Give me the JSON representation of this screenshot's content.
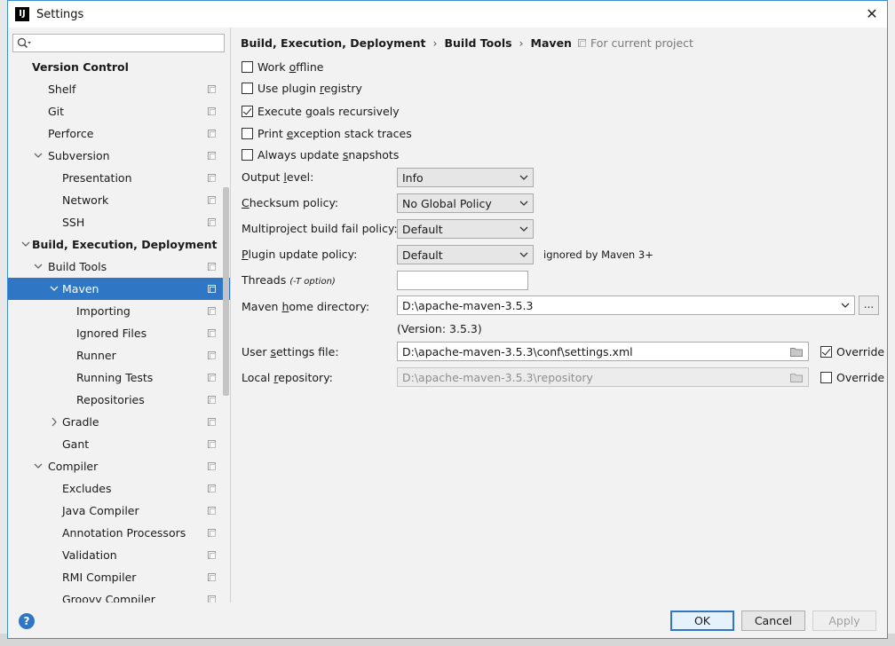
{
  "window": {
    "title": "Settings",
    "app_icon_text": "IJ",
    "close_glyph": "✕"
  },
  "sidebar": {
    "search": {
      "value": "",
      "placeholder": ""
    },
    "items": [
      {
        "label": "Version Control",
        "level": 0,
        "bold": true,
        "arrow": "",
        "project": false
      },
      {
        "label": "Shelf",
        "level": 1,
        "arrow": "",
        "project": true
      },
      {
        "label": "Git",
        "level": 1,
        "arrow": "",
        "project": true
      },
      {
        "label": "Perforce",
        "level": 1,
        "arrow": "",
        "project": true
      },
      {
        "label": "Subversion",
        "level": 1,
        "arrow": "expanded",
        "project": true
      },
      {
        "label": "Presentation",
        "level": 2,
        "arrow": "",
        "project": true
      },
      {
        "label": "Network",
        "level": 2,
        "arrow": "",
        "project": true
      },
      {
        "label": "SSH",
        "level": 2,
        "arrow": "",
        "project": true
      },
      {
        "label": "Build, Execution, Deployment",
        "level": 0,
        "bold": true,
        "arrow": "expanded",
        "project": false
      },
      {
        "label": "Build Tools",
        "level": 1,
        "arrow": "expanded",
        "project": true
      },
      {
        "label": "Maven",
        "level": 2,
        "arrow": "expanded",
        "project": true,
        "selected": true
      },
      {
        "label": "Importing",
        "level": 3,
        "arrow": "",
        "project": true
      },
      {
        "label": "Ignored Files",
        "level": 3,
        "arrow": "",
        "project": true
      },
      {
        "label": "Runner",
        "level": 3,
        "arrow": "",
        "project": true
      },
      {
        "label": "Running Tests",
        "level": 3,
        "arrow": "",
        "project": true
      },
      {
        "label": "Repositories",
        "level": 3,
        "arrow": "",
        "project": true
      },
      {
        "label": "Gradle",
        "level": 2,
        "arrow": "collapsed",
        "project": true
      },
      {
        "label": "Gant",
        "level": 2,
        "arrow": "",
        "project": true
      },
      {
        "label": "Compiler",
        "level": 1,
        "arrow": "expanded",
        "project": true
      },
      {
        "label": "Excludes",
        "level": 2,
        "arrow": "",
        "project": true
      },
      {
        "label": "Java Compiler",
        "level": 2,
        "arrow": "",
        "project": true
      },
      {
        "label": "Annotation Processors",
        "level": 2,
        "arrow": "",
        "project": true
      },
      {
        "label": "Validation",
        "level": 2,
        "arrow": "",
        "project": true
      },
      {
        "label": "RMI Compiler",
        "level": 2,
        "arrow": "",
        "project": true
      },
      {
        "label": "Groovy Compiler",
        "level": 2,
        "arrow": "",
        "project": true
      }
    ]
  },
  "content": {
    "breadcrumb": {
      "part1": "Build, Execution, Deployment",
      "part2": "Build Tools",
      "part3": "Maven",
      "separator": "›"
    },
    "for_project": "For current project",
    "checkboxes": {
      "work_offline": {
        "pre": "Work ",
        "mn": "o",
        "post": "ffline",
        "checked": false
      },
      "plugin_registry": {
        "pre": "Use plugin ",
        "mn": "r",
        "post": "egistry",
        "checked": false
      },
      "execute_goals": {
        "pre": "Execute ",
        "mn": "g",
        "post": "oals recursively",
        "checked": true
      },
      "print_exception": {
        "pre": "Print ",
        "mn": "e",
        "post": "xception stack traces",
        "checked": false
      },
      "update_snapshots": {
        "pre": "Always update ",
        "mn": "s",
        "post": "napshots",
        "checked": false
      }
    },
    "output_level": {
      "pre": "Output ",
      "mn": "l",
      "post": "evel:",
      "value": "Info"
    },
    "checksum_policy": {
      "pre": "",
      "mn": "C",
      "post": "hecksum policy:",
      "value": "No Global Policy"
    },
    "multiproject": {
      "pre": "Multiproject build fail policy:",
      "value": "Default"
    },
    "plugin_update": {
      "pre": "",
      "mn": "P",
      "post": "lugin update policy:",
      "value": "Default",
      "note": "ignored by Maven 3+"
    },
    "threads": {
      "label": "Threads",
      "note": "(-T option)",
      "value": ""
    },
    "maven_home": {
      "pre": "Maven ",
      "mn": "h",
      "post": "ome directory:",
      "value": "D:\\apache-maven-3.5.3",
      "browse": "...",
      "version": "(Version: 3.5.3)"
    },
    "user_settings": {
      "pre": "User ",
      "mn": "s",
      "post": "ettings file:",
      "value": "D:\\apache-maven-3.5.3\\conf\\settings.xml",
      "override_label": "Override",
      "override_checked": true
    },
    "local_repo": {
      "pre": "Local ",
      "mn": "r",
      "post": "epository:",
      "value": "D:\\apache-maven-3.5.3\\repository",
      "override_label": "Override",
      "override_checked": false
    }
  },
  "footer": {
    "help": "?",
    "ok": "OK",
    "cancel": "Cancel",
    "apply": "Apply"
  },
  "colors": {
    "selection": "#2f76c5",
    "window_border": "#3c8ed6",
    "background": "#f2f2f2"
  }
}
